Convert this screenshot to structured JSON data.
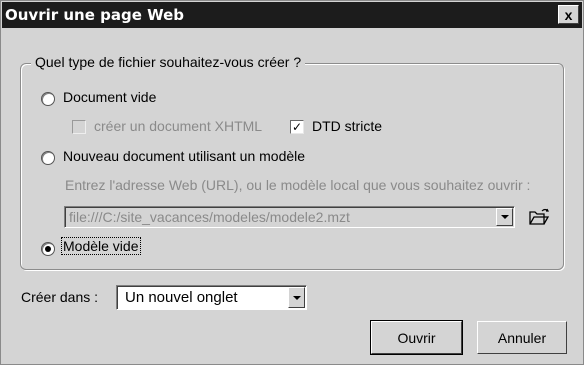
{
  "window": {
    "title": "Ouvrir une page Web",
    "close_label": "x"
  },
  "group": {
    "legend": "Quel type de fichier souhaitez-vous créer ?"
  },
  "options": {
    "document_vide": {
      "label": "Document vide",
      "selected": false
    },
    "creer_xhtml": {
      "label": "créer un document XHTML",
      "checked": false,
      "enabled": false
    },
    "dtd_stricte": {
      "label": "DTD stricte",
      "checked": true
    },
    "nouveau_modele": {
      "label": "Nouveau document utilisant un modèle",
      "selected": false
    },
    "url_hint": "Entrez l'adresse Web (URL), ou le modèle local que vous souhaitez ouvrir :",
    "url_value": "file:///C:/site_vacances/modeles/modele2.mzt",
    "modele_vide": {
      "label": "Modèle vide",
      "selected": true
    }
  },
  "creer_dans": {
    "label": "Créer dans :",
    "value": "Un nouvel onglet"
  },
  "buttons": {
    "ouvrir": "Ouvrir",
    "annuler": "Annuler"
  },
  "icons": {
    "close": "close-icon",
    "dropdown": "chevron-down-icon",
    "browse": "folder-open-icon"
  }
}
